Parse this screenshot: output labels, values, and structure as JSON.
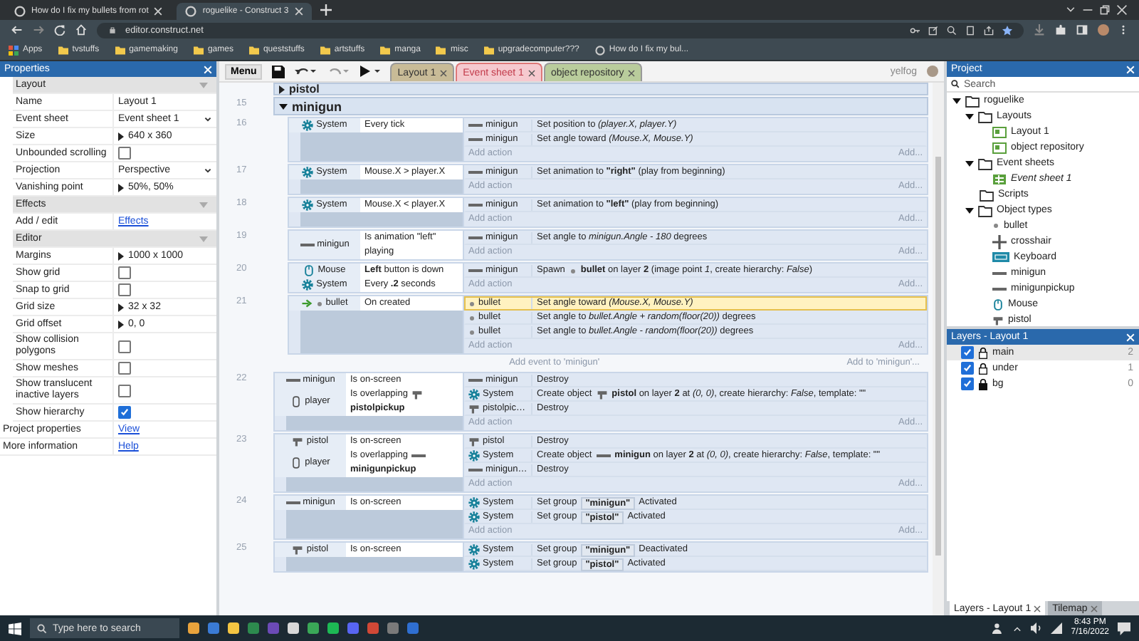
{
  "browser": {
    "tabs": [
      {
        "title": "How do I fix my bullets from rot",
        "selected": false
      },
      {
        "title": "roguelike - Construct 3",
        "selected": true
      }
    ],
    "address": "editor.construct.net",
    "bookmarks": [
      "Apps",
      "tvstuffs",
      "gamemaking",
      "games",
      "queststuffs",
      "artstuffs",
      "manga",
      "misc",
      "upgradecomputer???",
      "How do I fix my bul..."
    ]
  },
  "properties": {
    "title": "Properties",
    "rows": [
      {
        "kind": "section",
        "label": "Layout"
      },
      {
        "kind": "text",
        "label": "Name",
        "value": "Layout 1"
      },
      {
        "kind": "dropdown",
        "label": "Event sheet",
        "value": "Event sheet 1"
      },
      {
        "kind": "expand",
        "label": "Size",
        "value": "640 x 360"
      },
      {
        "kind": "checkbox",
        "label": "Unbounded scrolling",
        "checked": false
      },
      {
        "kind": "dropdown",
        "label": "Projection",
        "value": "Perspective"
      },
      {
        "kind": "expand",
        "label": "Vanishing point",
        "value": "50%, 50%"
      },
      {
        "kind": "section",
        "label": "Effects"
      },
      {
        "kind": "link",
        "label": "Add / edit",
        "value": "Effects"
      },
      {
        "kind": "section",
        "label": "Editor"
      },
      {
        "kind": "expand",
        "label": "Margins",
        "value": "1000 x 1000"
      },
      {
        "kind": "checkbox",
        "label": "Show grid",
        "checked": false
      },
      {
        "kind": "checkbox",
        "label": "Snap to grid",
        "checked": false
      },
      {
        "kind": "expand",
        "label": "Grid size",
        "value": "32 x 32"
      },
      {
        "kind": "expand",
        "label": "Grid offset",
        "value": "0, 0"
      },
      {
        "kind": "checkbox",
        "label": "Show collision polygons",
        "checked": false
      },
      {
        "kind": "checkbox",
        "label": "Show meshes",
        "checked": false
      },
      {
        "kind": "checkbox",
        "label": "Show translucent inactive layers",
        "checked": false
      },
      {
        "kind": "checkbox",
        "label": "Show hierarchy",
        "checked": true
      },
      {
        "kind": "toplink",
        "label": "Project properties",
        "value": "View"
      },
      {
        "kind": "toplink",
        "label": "More information",
        "value": "Help"
      }
    ]
  },
  "toolbar": {
    "menu": "Menu",
    "user": "yelfog",
    "tabs": [
      {
        "label": "Layout 1",
        "selected": false,
        "color": "#c8bb97"
      },
      {
        "label": "Event sheet 1",
        "selected": true,
        "color": "#f6c9cf"
      },
      {
        "label": "object repository",
        "selected": false,
        "color": "#b9cc9c"
      }
    ]
  },
  "event_sheet": {
    "groups": [
      {
        "name": "pistol",
        "expanded": false
      },
      {
        "name": "minigun",
        "number": "15",
        "expanded": true,
        "add_event": "Add event to 'minigun'",
        "add_to": "Add to 'minigun'...",
        "events": [
          {
            "number": "16",
            "conditions": [
              {
                "kind": "system",
                "object": "System",
                "text": "Every tick",
                "trigger": false
              }
            ],
            "actions": [
              {
                "kind": "minigun",
                "object": "minigun",
                "text": "Set position to *(player.X, player.Y)*",
                "selected": false
              },
              {
                "kind": "minigun",
                "object": "minigun",
                "text": "Set angle toward *(Mouse.X, Mouse.Y)*",
                "selected": false
              }
            ],
            "add_action": "Add action",
            "add_more": "Add..."
          },
          {
            "number": "17",
            "conditions": [
              {
                "kind": "system",
                "object": "System",
                "text": "Mouse.X > player.X",
                "trigger": false
              }
            ],
            "actions": [
              {
                "kind": "minigun",
                "object": "minigun",
                "text": "Set animation to **\"right\"** (play from beginning)",
                "selected": false
              }
            ],
            "add_action": "Add action",
            "add_more": "Add..."
          },
          {
            "number": "18",
            "conditions": [
              {
                "kind": "system",
                "object": "System",
                "text": "Mouse.X < player.X",
                "trigger": false
              }
            ],
            "actions": [
              {
                "kind": "minigun",
                "object": "minigun",
                "text": "Set animation to **\"left\"** (play from beginning)",
                "selected": false
              }
            ],
            "add_action": "Add action",
            "add_more": "Add..."
          },
          {
            "number": "19",
            "conditions": [
              {
                "kind": "minigun",
                "object": "minigun",
                "text": "Is animation \"left\" playing",
                "trigger": false
              }
            ],
            "actions": [
              {
                "kind": "minigun",
                "object": "minigun",
                "text": "Set angle to *minigun.Angle - 180* degrees",
                "selected": false
              }
            ],
            "add_action": "Add action",
            "add_more": "Add..."
          },
          {
            "number": "20",
            "conditions": [
              {
                "kind": "mouse",
                "object": "Mouse",
                "text": "**Left** button is down",
                "trigger": false
              },
              {
                "kind": "system",
                "object": "System",
                "text": "Every **.2** seconds",
                "trigger": false
              }
            ],
            "actions": [
              {
                "kind": "minigun",
                "object": "minigun",
                "text": "Spawn",
                "param": {
                  "kind": "bullet"
                },
                "text2": "**bullet** on layer **2** (image point *1*, create hierarchy: *False*)",
                "selected": false
              }
            ],
            "add_action": "Add action",
            "add_more": "Add..."
          },
          {
            "number": "21",
            "conditions": [
              {
                "kind": "bullet",
                "object": "bullet",
                "text": "On created",
                "trigger": true
              }
            ],
            "actions": [
              {
                "kind": "bullet",
                "object": "bullet",
                "text": "Set angle toward *(Mouse.X, Mouse.Y)*",
                "selected": true
              },
              {
                "kind": "bullet",
                "object": "bullet",
                "text": "Set angle to *bullet.Angle + random(floor(20))* degrees",
                "selected": false
              },
              {
                "kind": "bullet",
                "object": "bullet",
                "text": "Set angle to *bullet.Angle - random(floor(20))* degrees",
                "selected": false
              }
            ],
            "add_action": "Add action",
            "add_more": "Add..."
          }
        ]
      }
    ],
    "events": [
      {
        "number": "22",
        "conditions": [
          {
            "kind": "minigun",
            "object": "minigun",
            "text": "Is on-screen",
            "trigger": false
          },
          {
            "kind": "player",
            "object": "player",
            "text": "Is overlapping",
            "param": {
              "kind": "pistol",
              "text": "pistolpickup"
            },
            "trigger": false
          }
        ],
        "actions": [
          {
            "kind": "minigun",
            "object": "minigun",
            "text": "Destroy",
            "selected": false
          },
          {
            "kind": "system",
            "object": "System",
            "text": "Create object",
            "param": {
              "kind": "pistol"
            },
            "text2": "**pistol** on layer **2** at *(0, 0)*, create hierarchy: *False*, template: \"\"",
            "selected": false
          },
          {
            "kind": "pistol",
            "object": "pistolpic…",
            "text": "Destroy",
            "selected": false
          }
        ],
        "add_action": "Add action",
        "add_more": "Add..."
      },
      {
        "number": "23",
        "conditions": [
          {
            "kind": "pistol",
            "object": "pistol",
            "text": "Is on-screen",
            "trigger": false
          },
          {
            "kind": "player",
            "object": "player",
            "text": "Is overlapping",
            "param": {
              "kind": "minigun",
              "text": "minigunpickup"
            },
            "trigger": false
          }
        ],
        "actions": [
          {
            "kind": "pistol",
            "object": "pistol",
            "text": "Destroy",
            "selected": false
          },
          {
            "kind": "system",
            "object": "System",
            "text": "Create object",
            "param": {
              "kind": "minigun"
            },
            "text2": "**minigun** on layer **2** at *(0, 0)*, create hierarchy: *False*, template: \"\"",
            "selected": false
          },
          {
            "kind": "minigun",
            "object": "minigun…",
            "text": "Destroy",
            "selected": false
          }
        ],
        "add_action": "Add action",
        "add_more": "Add..."
      },
      {
        "number": "24",
        "conditions": [
          {
            "kind": "minigun",
            "object": "minigun",
            "text": "Is on-screen",
            "trigger": false
          }
        ],
        "actions": [
          {
            "kind": "system",
            "object": "System",
            "text": "Set group",
            "chip": "\"minigun\"",
            "text2": "Activated",
            "selected": false
          },
          {
            "kind": "system",
            "object": "System",
            "text": "Set group",
            "chip": "\"pistol\"",
            "text2": "Activated",
            "selected": false
          }
        ],
        "add_action": "Add action",
        "add_more": "Add..."
      },
      {
        "number": "25",
        "conditions": [
          {
            "kind": "pistol",
            "object": "pistol",
            "text": "Is on-screen",
            "trigger": false
          }
        ],
        "actions": [
          {
            "kind": "system",
            "object": "System",
            "text": "Set group",
            "chip": "\"minigun\"",
            "text2": "Deactivated",
            "selected": false
          },
          {
            "kind": "system",
            "object": "System",
            "text": "Set group",
            "chip": "\"pistol\"",
            "text2": "Activated",
            "selected": false
          }
        ]
      }
    ]
  },
  "project": {
    "title": "Project",
    "search": {
      "placeholder": "Search"
    },
    "tree": [
      {
        "label": "roguelike",
        "kind": "folder",
        "expanded": true,
        "children": [
          {
            "label": "Layouts",
            "kind": "folder",
            "expanded": true,
            "children": [
              {
                "label": "Layout 1",
                "kind": "layout"
              },
              {
                "label": "object repository",
                "kind": "layout"
              }
            ]
          },
          {
            "label": "Event sheets",
            "kind": "folder",
            "expanded": true,
            "children": [
              {
                "label": "Event sheet 1",
                "kind": "eventsheet"
              }
            ]
          },
          {
            "label": "Scripts",
            "kind": "folder"
          },
          {
            "label": "Object types",
            "kind": "folder",
            "expanded": true,
            "children": [
              {
                "label": "bullet",
                "kind": "bullet"
              },
              {
                "label": "crosshair",
                "kind": "crosshair"
              },
              {
                "label": "Keyboard",
                "kind": "keyboard"
              },
              {
                "label": "minigun",
                "kind": "minigun"
              },
              {
                "label": "minigunpickup",
                "kind": "minigun"
              },
              {
                "label": "Mouse",
                "kind": "mouse"
              },
              {
                "label": "pistol",
                "kind": "pistol"
              }
            ]
          }
        ]
      }
    ]
  },
  "layers": {
    "title": "Layers - Layout 1",
    "rows": [
      {
        "name": "main",
        "number": "2",
        "visible": true,
        "locked": false,
        "selected": true
      },
      {
        "name": "under",
        "number": "1",
        "visible": true,
        "locked": false,
        "selected": false
      },
      {
        "name": "bg",
        "number": "0",
        "visible": true,
        "locked": true,
        "selected": false
      }
    ],
    "tabs": [
      {
        "label": "Layers - Layout 1",
        "selected": true
      },
      {
        "label": "Tilemap",
        "selected": false
      }
    ]
  },
  "taskbar": {
    "search": {
      "placeholder": "Type here to search"
    },
    "time": "8:43 PM",
    "date": "7/16/2022"
  }
}
